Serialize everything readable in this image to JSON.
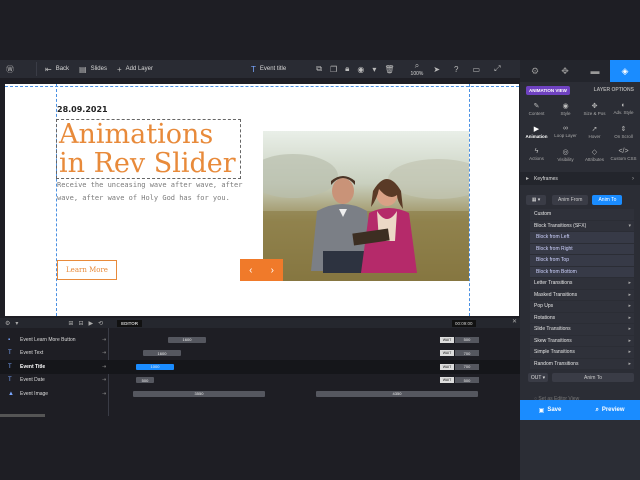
{
  "toolbar": {
    "wp_icon": "wordpress-icon",
    "back": "Back",
    "slides": "Slides",
    "add_layer": "Add Layer",
    "layer_name": "Event title",
    "zoom": "100%"
  },
  "canvas": {
    "date": "28.09.2021",
    "title": "Animations in Rev Slider",
    "text": "Receive the unceasing wave after wave, after wave, after wave of Holy God has for you.",
    "button": "Learn More"
  },
  "panel": {
    "badge": "ANIMATION VIEW",
    "layer_options": "LAYER OPTIONS",
    "grid": [
      {
        "label": "Content",
        "icon": "pencil-icon",
        "glyph": "✎"
      },
      {
        "label": "Style",
        "icon": "palette-icon",
        "glyph": "◉"
      },
      {
        "label": "Size & Pos",
        "icon": "move-icon",
        "glyph": "✥"
      },
      {
        "label": "Adv. Style",
        "icon": "contrast-icon",
        "glyph": "◐"
      },
      {
        "label": "Animation",
        "icon": "play-icon",
        "glyph": "▶"
      },
      {
        "label": "Loop Layer",
        "icon": "loop-icon",
        "glyph": "∞"
      },
      {
        "label": "Hover",
        "icon": "cursor-icon",
        "glyph": "➚"
      },
      {
        "label": "On Scroll",
        "icon": "scroll-icon",
        "glyph": "⇕"
      },
      {
        "label": "Actions",
        "icon": "bolt-icon",
        "glyph": "ϟ"
      },
      {
        "label": "Visibility",
        "icon": "eye-icon",
        "glyph": "◎"
      },
      {
        "label": "Attributes",
        "icon": "tag-icon",
        "glyph": "◇"
      },
      {
        "label": "Custom CSS",
        "icon": "code-icon",
        "glyph": "</>"
      }
    ],
    "keyframes": "Keyframes",
    "frame_select": "▦ ▾",
    "anim_from": "Anim From",
    "anim_to": "Anim To",
    "list": [
      {
        "label": "Custom",
        "sub": false,
        "arrow": ""
      },
      {
        "label": "Block Transitions (SFX)",
        "sub": false,
        "arrow": "▾"
      },
      {
        "label": "Block from Left",
        "sub": true,
        "arrow": ""
      },
      {
        "label": "Block from Right",
        "sub": true,
        "arrow": ""
      },
      {
        "label": "Block from Top",
        "sub": true,
        "arrow": ""
      },
      {
        "label": "Block from Bottom",
        "sub": true,
        "arrow": ""
      },
      {
        "label": "Letter Transitions",
        "sub": false,
        "arrow": "▸"
      },
      {
        "label": "Masked Transitions",
        "sub": false,
        "arrow": "▸"
      },
      {
        "label": "Pop Ups",
        "sub": false,
        "arrow": "▸"
      },
      {
        "label": "Rotations",
        "sub": false,
        "arrow": "▸"
      },
      {
        "label": "Slide Transitions",
        "sub": false,
        "arrow": "▸"
      },
      {
        "label": "Skew Transitions",
        "sub": false,
        "arrow": "▸"
      },
      {
        "label": "Simple Transitions",
        "sub": false,
        "arrow": "▸"
      },
      {
        "label": "Random Transitions",
        "sub": false,
        "arrow": "▸"
      }
    ],
    "out_label": "OUT ▾",
    "out_anim_to": "Anim To",
    "editor_view": "Set as Editor View",
    "save": "Save",
    "preview": "Preview"
  },
  "timeline": {
    "editor": "EDITOR",
    "time": "00:09:00",
    "rows": [
      {
        "name": "Event Learn More Button",
        "icon": "text-icon",
        "glyph": "▪",
        "active": false,
        "bars": [
          {
            "value": "1600",
            "color": "gray"
          }
        ],
        "wait": "WAIT",
        "out": "500"
      },
      {
        "name": "Event Text",
        "icon": "text-icon",
        "glyph": "T",
        "active": false,
        "bars": [
          {
            "value": "1600",
            "color": "gray"
          }
        ],
        "wait": "WAIT",
        "out": "700"
      },
      {
        "name": "Event Title",
        "icon": "text-icon",
        "glyph": "T",
        "active": true,
        "bars": [
          {
            "value": "1000",
            "color": "blue"
          }
        ],
        "wait": "WAIT",
        "out": "700"
      },
      {
        "name": "Event Date",
        "icon": "text-icon",
        "glyph": "T",
        "active": false,
        "bars": [
          {
            "value": "500",
            "color": "gray"
          }
        ],
        "wait": "WAIT",
        "out": "500"
      },
      {
        "name": "Event Image",
        "icon": "image-icon",
        "glyph": "▲",
        "active": false,
        "bars": [
          {
            "value": "3550",
            "color": "gray"
          },
          {
            "value": "4350",
            "color": "gray"
          }
        ],
        "wait": "",
        "out": ""
      }
    ]
  }
}
